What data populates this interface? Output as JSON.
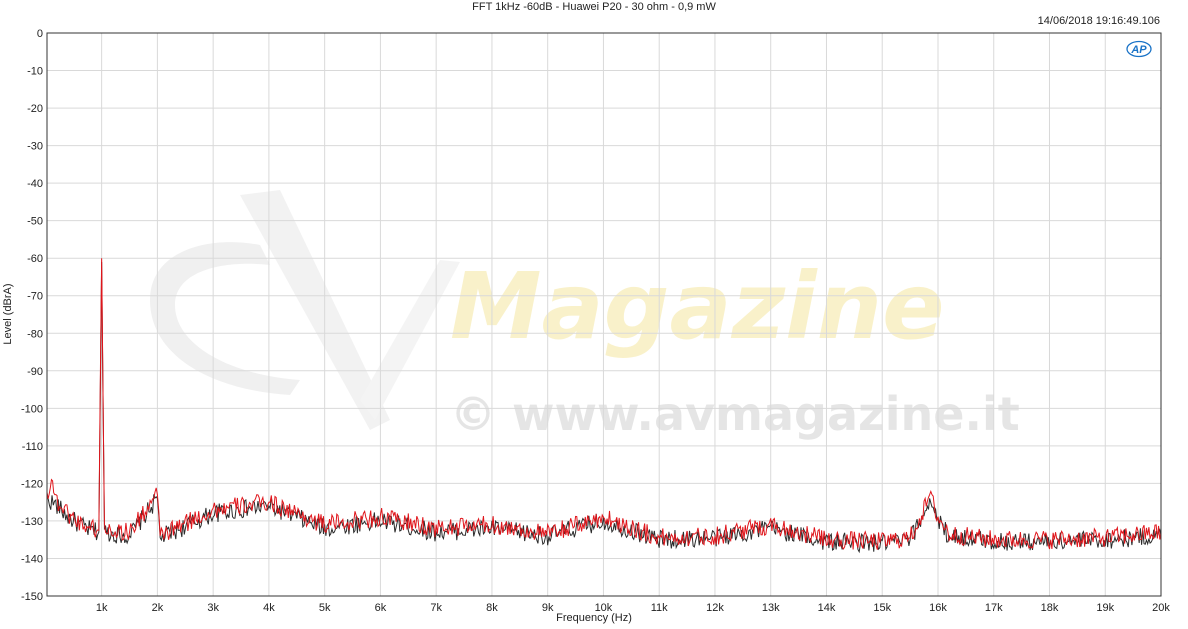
{
  "chart_data": {
    "type": "line",
    "title": "FFT 1kHz -60dB - Huawei P20 - 30 ohm - 0,9 mW",
    "timestamp": "14/06/2018 19:16:49.106",
    "xlabel": "Frequency (Hz)",
    "ylabel": "Level (dBrA)",
    "xlim": [
      20,
      20000
    ],
    "ylim": [
      -150,
      0
    ],
    "x_ticks": [
      {
        "value": 1000,
        "label": "1k"
      },
      {
        "value": 2000,
        "label": "2k"
      },
      {
        "value": 3000,
        "label": "3k"
      },
      {
        "value": 4000,
        "label": "4k"
      },
      {
        "value": 5000,
        "label": "5k"
      },
      {
        "value": 6000,
        "label": "6k"
      },
      {
        "value": 7000,
        "label": "7k"
      },
      {
        "value": 8000,
        "label": "8k"
      },
      {
        "value": 9000,
        "label": "9k"
      },
      {
        "value": 10000,
        "label": "10k"
      },
      {
        "value": 11000,
        "label": "11k"
      },
      {
        "value": 12000,
        "label": "12k"
      },
      {
        "value": 13000,
        "label": "13k"
      },
      {
        "value": 14000,
        "label": "14k"
      },
      {
        "value": 15000,
        "label": "15k"
      },
      {
        "value": 16000,
        "label": "16k"
      },
      {
        "value": 17000,
        "label": "17k"
      },
      {
        "value": 18000,
        "label": "18k"
      },
      {
        "value": 19000,
        "label": "19k"
      },
      {
        "value": 20000,
        "label": "20k"
      }
    ],
    "y_ticks": [
      0,
      -10,
      -20,
      -30,
      -40,
      -50,
      -60,
      -70,
      -80,
      -90,
      -100,
      -110,
      -120,
      -130,
      -140,
      -150
    ],
    "grid": true,
    "series": [
      {
        "color": "#2b2b2b",
        "noise_floor": -135.5,
        "points": [
          [
            20,
            -124
          ],
          [
            200,
            -126
          ],
          [
            400,
            -129
          ],
          [
            600,
            -131
          ],
          [
            800,
            -132.5
          ],
          [
            950,
            -133
          ],
          [
            1000,
            -61
          ],
          [
            1050,
            -133
          ],
          [
            1500,
            -134
          ],
          [
            2000,
            -124
          ],
          [
            2050,
            -134.5
          ],
          [
            3000,
            -128
          ],
          [
            4000,
            -126
          ],
          [
            5000,
            -132
          ],
          [
            6000,
            -130
          ],
          [
            7000,
            -133
          ],
          [
            8000,
            -132
          ],
          [
            9000,
            -134
          ],
          [
            10000,
            -130
          ],
          [
            11000,
            -135
          ],
          [
            12000,
            -134.5
          ],
          [
            13000,
            -132
          ],
          [
            14000,
            -135.5
          ],
          [
            15000,
            -136
          ],
          [
            15500,
            -135
          ],
          [
            15750,
            -128
          ],
          [
            15850,
            -124
          ],
          [
            16000,
            -130
          ],
          [
            16200,
            -134
          ],
          [
            17000,
            -135.5
          ],
          [
            18000,
            -135.5
          ],
          [
            19000,
            -135
          ],
          [
            20000,
            -134
          ]
        ]
      },
      {
        "color": "#e0151b",
        "noise_floor": -134.5,
        "points": [
          [
            20,
            -123
          ],
          [
            100,
            -119
          ],
          [
            200,
            -125
          ],
          [
            400,
            -128
          ],
          [
            600,
            -130.5
          ],
          [
            800,
            -131.5
          ],
          [
            950,
            -132.5
          ],
          [
            1000,
            -60
          ],
          [
            1050,
            -132
          ],
          [
            1500,
            -133
          ],
          [
            2000,
            -123
          ],
          [
            2050,
            -134
          ],
          [
            3000,
            -127
          ],
          [
            4000,
            -125
          ],
          [
            5000,
            -131
          ],
          [
            6000,
            -129
          ],
          [
            7000,
            -132
          ],
          [
            8000,
            -131
          ],
          [
            9000,
            -133.5
          ],
          [
            10000,
            -129
          ],
          [
            11000,
            -134.5
          ],
          [
            12000,
            -134
          ],
          [
            13000,
            -131
          ],
          [
            14000,
            -135
          ],
          [
            15000,
            -135.5
          ],
          [
            15500,
            -134.5
          ],
          [
            15750,
            -127
          ],
          [
            15850,
            -123
          ],
          [
            16000,
            -129
          ],
          [
            16200,
            -133.5
          ],
          [
            17000,
            -135
          ],
          [
            18000,
            -135
          ],
          [
            19000,
            -134.5
          ],
          [
            20000,
            -133
          ]
        ]
      }
    ]
  },
  "watermark": {
    "brand_main": "AV",
    "brand": "Magazine",
    "url": "© www.avmagazine.it"
  },
  "logo": {
    "text": "AP",
    "color": "#1a73c7"
  },
  "colors": {
    "grid": "#d9d9d9",
    "axis": "#333333",
    "background": "#ffffff"
  }
}
